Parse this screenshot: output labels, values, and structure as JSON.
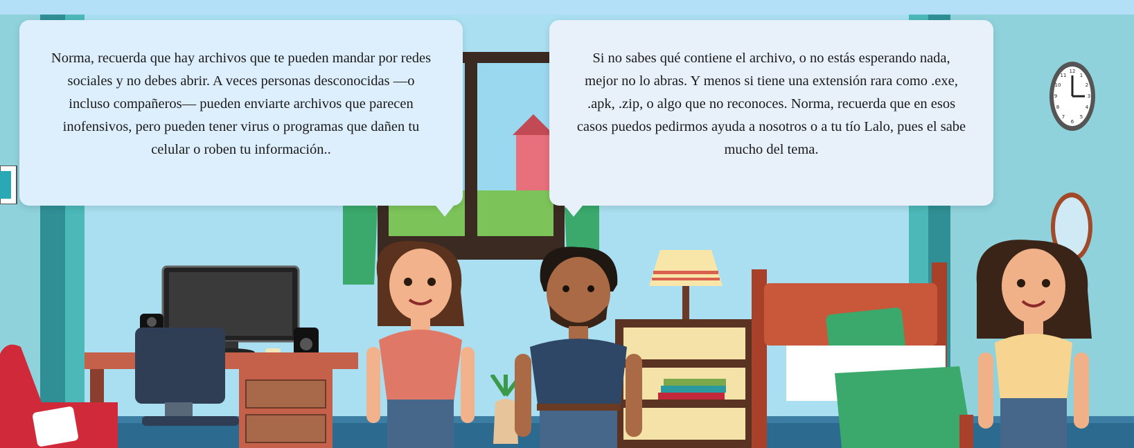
{
  "scene": {
    "name": "Bedroom scene",
    "colors": {
      "top_bar": "#b3e0f7",
      "wall": "#8fd2dc",
      "wall_inner": "#a9dff0",
      "bubble_left": "#ddeefc",
      "bubble_right": "#e8f0fa"
    }
  },
  "dialogue": {
    "left": {
      "text": "Norma, recuerda que hay archivos que te pueden mandar por redes sociales y no debes abrir. A veces personas desconocidas —o incluso compañeros— pueden enviarte archivos que parecen inofensivos, pero pueden tener virus o programas que dañen tu celular o roben tu información.."
    },
    "right": {
      "text": "Si no sabes qué contiene el archivo, o no estás esperando nada, mejor no lo abras. Y menos si tiene una extensión rara como .exe, .apk, .zip, o algo que no reconoces. Norma, recuerda que en esos casos puedos pedirmos ayuda a nosotros o a tu tío Lalo, pues el sabe mucho del tema."
    }
  },
  "clock": {
    "numbers": [
      "12",
      "1",
      "2",
      "3",
      "4",
      "5",
      "6",
      "7",
      "8",
      "9",
      "10",
      "11"
    ]
  },
  "characters": [
    {
      "id": "mother",
      "shirt": "#e07868"
    },
    {
      "id": "father",
      "shirt": "#2e4766"
    },
    {
      "id": "norma",
      "shirt": "#f7d48f"
    }
  ]
}
